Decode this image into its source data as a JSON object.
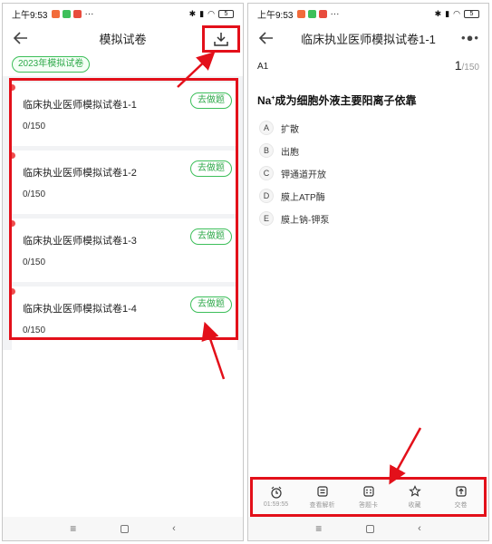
{
  "status": {
    "time": "上午9:53",
    "battery": "5",
    "dots": "···"
  },
  "left": {
    "title": "模拟试卷",
    "tag": "2023年模拟试卷",
    "go_label": "去做题",
    "papers": [
      {
        "name": "临床执业医师模拟试卷1-1",
        "progress": "0/150"
      },
      {
        "name": "临床执业医师模拟试卷1-2",
        "progress": "0/150"
      },
      {
        "name": "临床执业医师模拟试卷1-3",
        "progress": "0/150"
      },
      {
        "name": "临床执业医师模拟试卷1-4",
        "progress": "0/150"
      }
    ]
  },
  "right": {
    "title": "临床执业医师模拟试卷1-1",
    "more": "•●•",
    "question_type": "A1",
    "current": "1",
    "total": "/150",
    "question_prefix": "Na",
    "question_sup": "+",
    "question_rest": "成为细胞外液主要阳离子依靠",
    "options": [
      {
        "letter": "A",
        "text": "扩散"
      },
      {
        "letter": "B",
        "text": "出胞"
      },
      {
        "letter": "C",
        "text": "钾通道开放"
      },
      {
        "letter": "D",
        "text": "膜上ATP酶"
      },
      {
        "letter": "E",
        "text": "膜上钠-钾泵"
      }
    ],
    "toolbar": [
      {
        "label": "01:59:55",
        "icon": "alarm-clock-icon"
      },
      {
        "label": "查看解析",
        "icon": "analysis-icon"
      },
      {
        "label": "答题卡",
        "icon": "answer-card-icon"
      },
      {
        "label": "收藏",
        "icon": "star-icon"
      },
      {
        "label": "交卷",
        "icon": "submit-icon"
      }
    ]
  },
  "sysnav": {
    "menu": "≡",
    "back": "‹"
  },
  "colors": {
    "accent": "#3dbf5a",
    "highlight": "#e3101a",
    "dot": "#ee4d4d"
  }
}
